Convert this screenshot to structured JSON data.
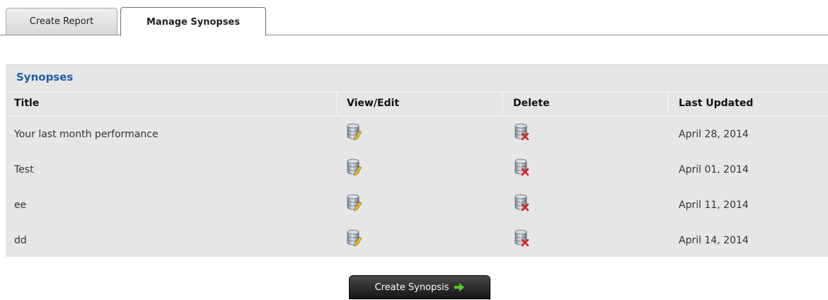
{
  "tabs": [
    {
      "label": "Create Report",
      "active": false
    },
    {
      "label": "Manage Synopses",
      "active": true
    }
  ],
  "panel": {
    "title": "Synopses",
    "columns": [
      "Title",
      "View/Edit",
      "Delete",
      "Last Updated"
    ],
    "rows": [
      {
        "title": "Your last month performance",
        "view_icon": "database-edit-icon",
        "delete_icon": "database-delete-icon",
        "last_updated": "April 28, 2014"
      },
      {
        "title": "Test",
        "view_icon": "database-edit-icon",
        "delete_icon": "database-delete-icon",
        "last_updated": "April 01, 2014"
      },
      {
        "title": "ee",
        "view_icon": "database-edit-icon",
        "delete_icon": "database-delete-icon",
        "last_updated": "April 11, 2014"
      },
      {
        "title": "dd",
        "view_icon": "database-edit-icon",
        "delete_icon": "database-delete-icon",
        "last_updated": "April 14, 2014"
      }
    ]
  },
  "actions": {
    "create_synopsis_label": "Create Synopsis",
    "arrow_icon": "arrow-right-icon"
  },
  "colors": {
    "panel_bg": "#e6e6e6",
    "title_blue": "#1f5da8",
    "button_bg": "#1a1a1a",
    "arrow_green": "#4fcf2a",
    "delete_red": "#d9251c"
  }
}
